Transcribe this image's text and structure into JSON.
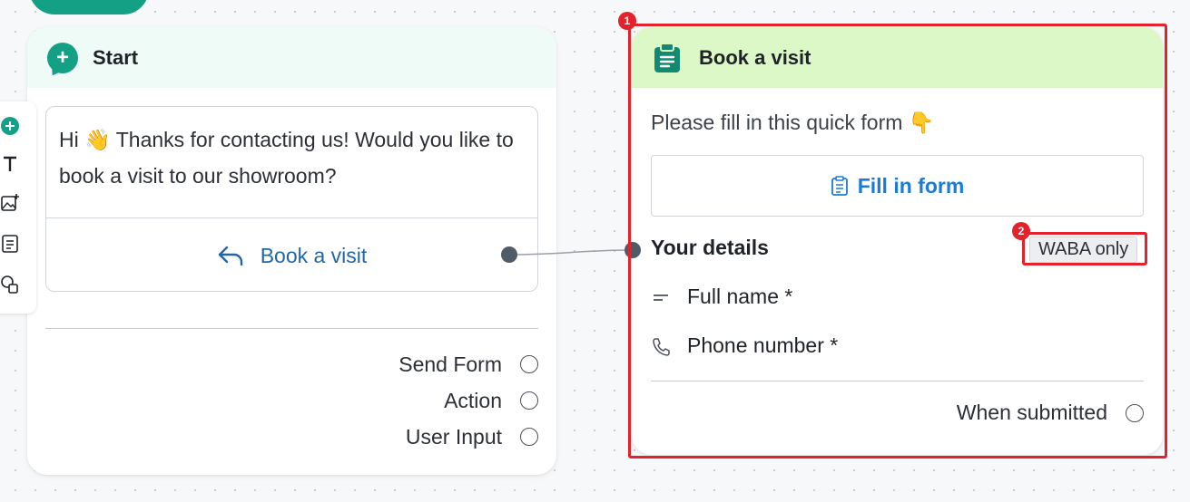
{
  "start_node": {
    "title": "Start",
    "message_text": "Hi 👋 Thanks for contacting us! Would you like to book a visit to our showroom?",
    "reply_button_label": "Book a visit",
    "outputs": [
      {
        "label": "Send Form"
      },
      {
        "label": "Action"
      },
      {
        "label": "User Input"
      }
    ]
  },
  "toolbar": {
    "items": [
      "add-icon",
      "text-icon",
      "image-icon",
      "list-icon",
      "shapes-icon"
    ]
  },
  "form_node": {
    "title": "Book a visit",
    "intro_text": "Please fill in this quick form 👇",
    "fill_button_label": "Fill in form",
    "details_title": "Your details",
    "badge": "WABA only",
    "fields": [
      {
        "label": "Full name *",
        "icon": "short-text-icon"
      },
      {
        "label": "Phone number *",
        "icon": "phone-icon"
      }
    ],
    "submitted_label": "When submitted"
  },
  "annotations": [
    {
      "number": "1"
    },
    {
      "number": "2"
    }
  ],
  "colors": {
    "accent": "#14a085",
    "link": "#2167a8",
    "highlight": "#e3222b",
    "start_header": "#eefbf6",
    "form_header": "#dcf8c6"
  }
}
